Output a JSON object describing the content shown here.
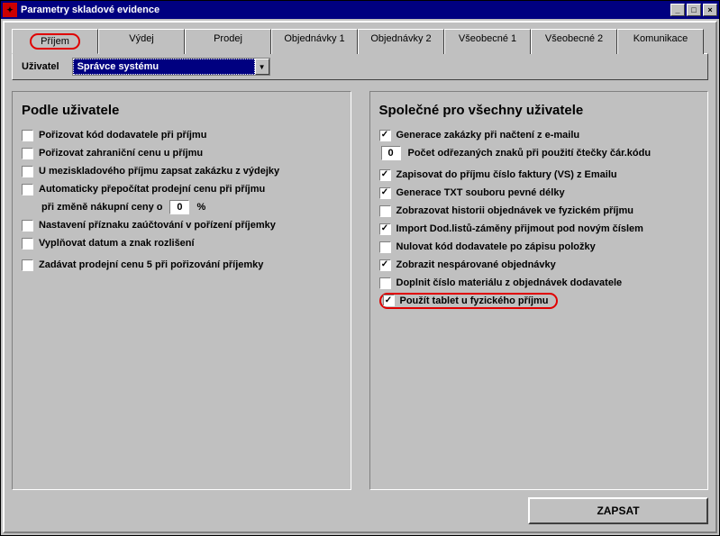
{
  "window": {
    "title": "Parametry skladové evidence"
  },
  "tabs": {
    "items": [
      {
        "label": "Příjem"
      },
      {
        "label": "Výdej"
      },
      {
        "label": "Prodej"
      },
      {
        "label": "Objednávky 1"
      },
      {
        "label": "Objednávky 2"
      },
      {
        "label": "Všeobecné 1"
      },
      {
        "label": "Všeobecné 2"
      },
      {
        "label": "Komunikace"
      }
    ],
    "active": 0
  },
  "user": {
    "label": "Uživatel",
    "selected": "Správce systému"
  },
  "left": {
    "title": "Podle uživatele",
    "items": [
      {
        "label": "Pořizovat kód dodavatele při příjmu",
        "checked": false
      },
      {
        "label": "Pořizovat zahraniční cenu u příjmu",
        "checked": false
      },
      {
        "label": "U meziskladového příjmu zapsat zakázku z výdejky",
        "checked": false
      },
      {
        "label": "Automaticky přepočítat prodejní cenu při příjmu",
        "checked": false
      },
      {
        "prefix": "při změně nákupní ceny o",
        "value": "0",
        "suffix": "%",
        "sub": true
      },
      {
        "label": "Nastavení příznaku zaúčtování v pořízení příjemky",
        "checked": false
      },
      {
        "label": "Vyplňovat datum a znak rozlišení",
        "checked": false
      },
      {
        "label": "Zadávat prodejní cenu 5 při pořizování příjemky",
        "checked": false
      }
    ]
  },
  "right": {
    "title": "Společné pro všechny uživatele",
    "items": [
      {
        "label": "Generace zakázky při načtení z e-mailu",
        "checked": true
      },
      {
        "value": "0",
        "suffix": "Počet odřezaných znaků při použití čtečky čár.kódu",
        "numeric": true
      },
      {
        "label": "Zapisovat do příjmu číslo faktury (VS) z Emailu",
        "checked": true
      },
      {
        "label": "Generace TXT souboru pevné délky",
        "checked": true
      },
      {
        "label": "Zobrazovat historii objednávek ve fyzickém příjmu",
        "checked": false
      },
      {
        "label": "Import Dod.listů-záměny přijmout pod novým číslem",
        "checked": true
      },
      {
        "label": "Nulovat  kód dodavatele po zápisu položky",
        "checked": false
      },
      {
        "label": "Zobrazit nespárované objednávky",
        "checked": true
      },
      {
        "label": "Doplnit číslo materiálu z objednávek dodavatele",
        "checked": false
      },
      {
        "label": "Použít tablet u fyzického příjmu",
        "checked": true,
        "highlight": true
      }
    ]
  },
  "footer": {
    "save": "ZAPSAT"
  }
}
